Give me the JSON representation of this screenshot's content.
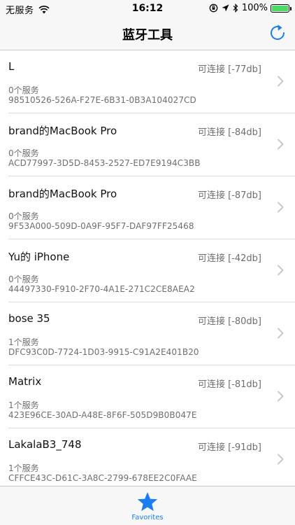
{
  "status_bar": {
    "carrier": "无服务",
    "time": "16:12",
    "battery": "100%",
    "battery_level": 1.0
  },
  "nav": {
    "title": "蓝牙工具",
    "refresh_icon": "refresh-icon"
  },
  "devices": [
    {
      "name": "L",
      "status": "可连接 [-77db]",
      "services": "0个服务",
      "uuid": "98510526-526A-F27E-6B31-0B3A104027CD"
    },
    {
      "name": "brand的MacBook Pro",
      "status": "可连接 [-84db]",
      "services": "0个服务",
      "uuid": "ACD77997-3D5D-8453-2527-ED7E9194C3BB"
    },
    {
      "name": "brand的MacBook Pro",
      "status": "可连接 [-87db]",
      "services": "0个服务",
      "uuid": "9F53A000-509D-0A9F-95F7-DAF97FF25468"
    },
    {
      "name": "Yu的 iPhone",
      "status": "可连接 [-42db]",
      "services": "0个服务",
      "uuid": "44497330-F910-2F70-4A1E-271C2CE8AEA2"
    },
    {
      "name": "bose 35",
      "status": "可连接 [-80db]",
      "services": "1个服务",
      "uuid": "DFC93C0D-7724-1D03-9915-C91A2E401B20"
    },
    {
      "name": "Matrix",
      "status": "可连接 [-81db]",
      "services": "1个服务",
      "uuid": "423E96CE-30AD-A48E-8F6F-505D9B0B047E"
    },
    {
      "name": "LakalaB3_748",
      "status": "可连接 [-91db]",
      "services": "1个服务",
      "uuid": "CFFCE43C-D61C-3A8C-2799-678EE2C0FAAE"
    }
  ],
  "tab_bar": {
    "favorites_label": "Favorites",
    "accent_color": "#1a7df0"
  }
}
